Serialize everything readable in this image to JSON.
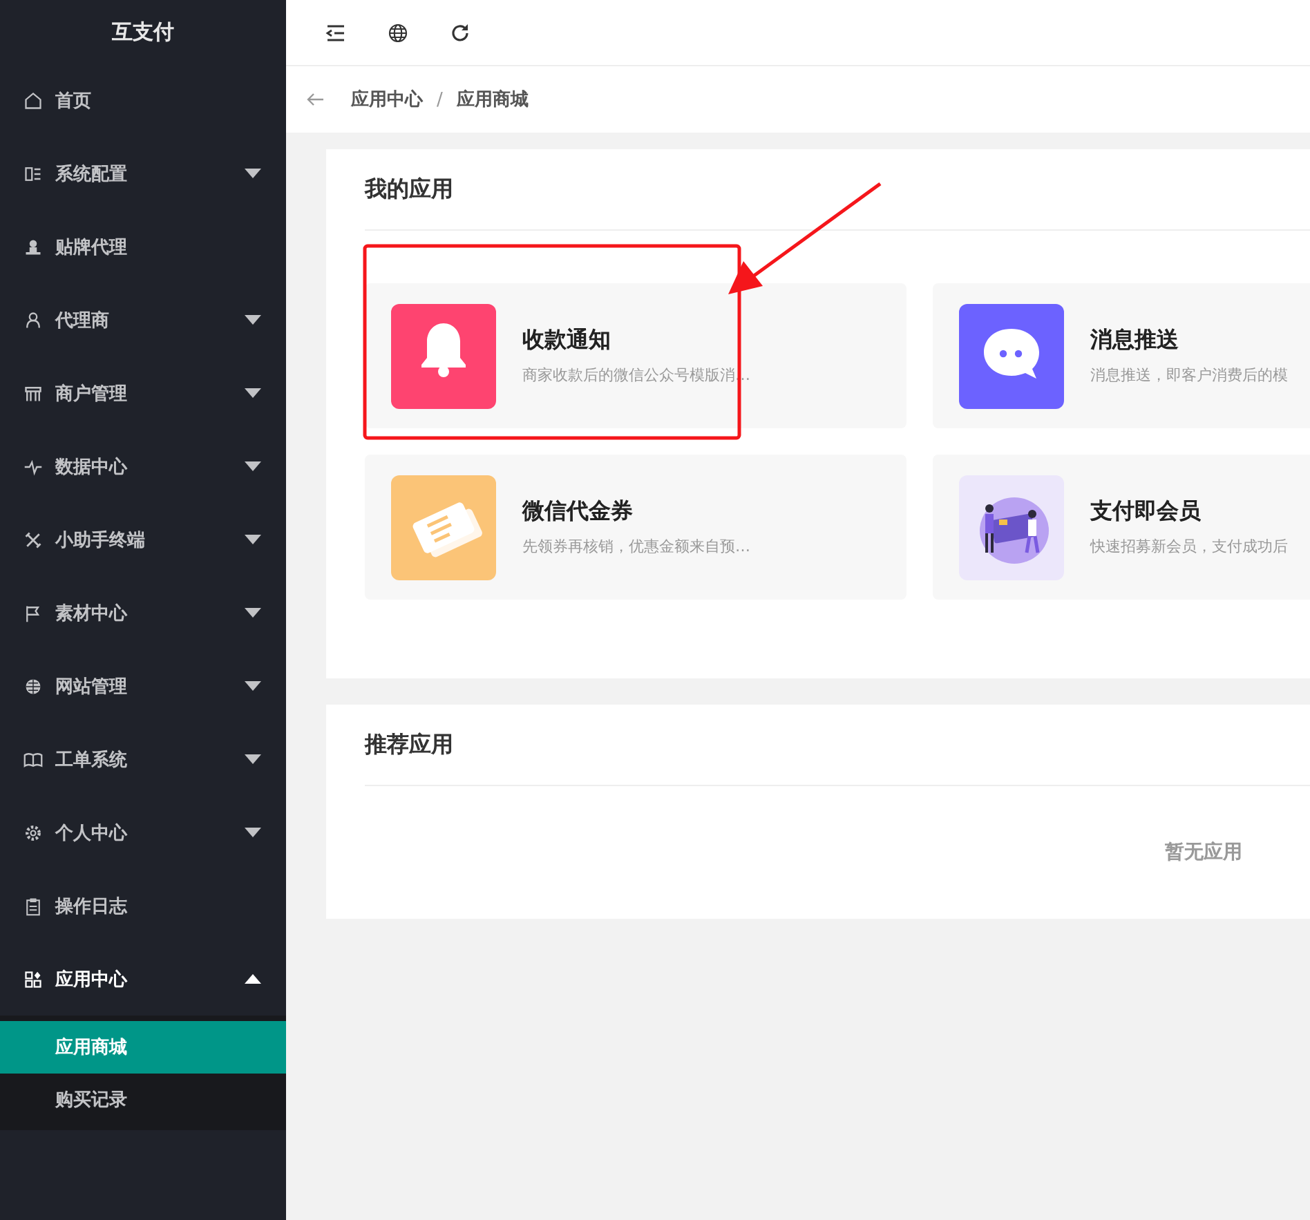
{
  "sidebar": {
    "logo": "互支付",
    "items": [
      {
        "label": "首页",
        "kind": "link"
      },
      {
        "label": "系统配置",
        "kind": "group",
        "expanded": false
      },
      {
        "label": "贴牌代理",
        "kind": "link"
      },
      {
        "label": "代理商",
        "kind": "group",
        "expanded": false
      },
      {
        "label": "商户管理",
        "kind": "group",
        "expanded": false
      },
      {
        "label": "数据中心",
        "kind": "group",
        "expanded": false
      },
      {
        "label": "小助手终端",
        "kind": "group",
        "expanded": false
      },
      {
        "label": "素材中心",
        "kind": "group",
        "expanded": false
      },
      {
        "label": "网站管理",
        "kind": "group",
        "expanded": false
      },
      {
        "label": "工单系统",
        "kind": "group",
        "expanded": false
      },
      {
        "label": "个人中心",
        "kind": "group",
        "expanded": false
      },
      {
        "label": "操作日志",
        "kind": "link"
      },
      {
        "label": "应用中心",
        "kind": "group",
        "expanded": true,
        "children": [
          {
            "label": "应用商城",
            "selected": true
          },
          {
            "label": "购买记录",
            "selected": false
          }
        ]
      }
    ]
  },
  "breadcrumb": [
    "应用中心",
    "应用商城"
  ],
  "breadcrumb_separator": "/",
  "panels": [
    {
      "title": "我的应用",
      "apps": [
        {
          "name": "收款通知",
          "description": "商家收款后的微信公众号模版消…",
          "color": "#fe4470"
        },
        {
          "name": "消息推送",
          "description": "消息推送，即客户消费后的模",
          "color": "#6c62ff"
        },
        {
          "name": "微信代金券",
          "description": "先领券再核销，优惠金额来自预…",
          "color": "#fbc477"
        },
        {
          "name": "支付即会员",
          "description": "快速招募新会员，支付成功后",
          "color": "#ece7fb"
        }
      ]
    },
    {
      "title": "推荐应用",
      "empty_text": "暂无应用"
    }
  ]
}
